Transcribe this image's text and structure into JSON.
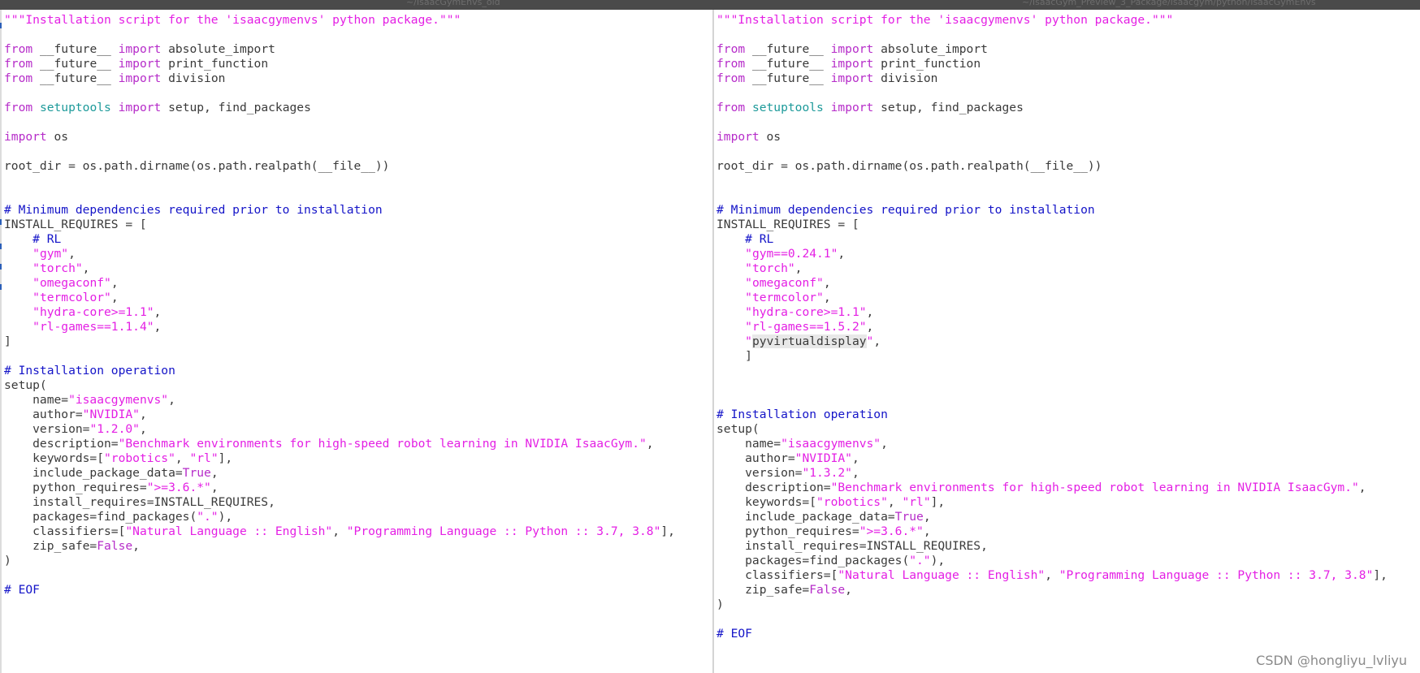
{
  "window": {
    "left_title": "~/IsaacGymEnvs_old",
    "right_title": "~/IsaacGym_Preview_3_Package/isaacgym/python/IsaacGymEnvs"
  },
  "watermark": "CSDN @hongliyu_lvliyu",
  "colors": {
    "keyword": "#b62cc9",
    "module": "#1d9a9a",
    "string": "#e41fe4",
    "comment": "#1414c8",
    "text": "#3a3a3a"
  },
  "left_pane": {
    "lines": [
      [
        [
          "str",
          "\"\"\"Installation script for the 'isaacgymenvs' python package.\"\"\""
        ]
      ],
      [],
      [
        [
          "kw",
          "from"
        ],
        [
          "t",
          " __future__ "
        ],
        [
          "kw",
          "import"
        ],
        [
          "t",
          " absolute_import"
        ]
      ],
      [
        [
          "kw",
          "from"
        ],
        [
          "t",
          " __future__ "
        ],
        [
          "kw",
          "import"
        ],
        [
          "t",
          " print_function"
        ]
      ],
      [
        [
          "kw",
          "from"
        ],
        [
          "t",
          " __future__ "
        ],
        [
          "kw",
          "import"
        ],
        [
          "t",
          " division"
        ]
      ],
      [],
      [
        [
          "kw",
          "from"
        ],
        [
          "t",
          " "
        ],
        [
          "mod",
          "setuptools"
        ],
        [
          "t",
          " "
        ],
        [
          "kw",
          "import"
        ],
        [
          "t",
          " setup, find_packages"
        ]
      ],
      [],
      [
        [
          "kw",
          "import"
        ],
        [
          "t",
          " os"
        ]
      ],
      [],
      [
        [
          "t",
          "root_dir = os.path.dirname(os.path.realpath(__file__))"
        ]
      ],
      [],
      [],
      [
        [
          "cmt",
          "# Minimum dependencies required prior to installation"
        ]
      ],
      [
        [
          "t",
          "INSTALL_REQUIRES = ["
        ]
      ],
      [
        [
          "t",
          "    "
        ],
        [
          "cmt",
          "# RL"
        ]
      ],
      [
        [
          "t",
          "    "
        ],
        [
          "str",
          "\"gym\""
        ],
        [
          "t",
          ","
        ]
      ],
      [
        [
          "t",
          "    "
        ],
        [
          "str",
          "\"torch\""
        ],
        [
          "t",
          ","
        ]
      ],
      [
        [
          "t",
          "    "
        ],
        [
          "str",
          "\"omegaconf\""
        ],
        [
          "t",
          ","
        ]
      ],
      [
        [
          "t",
          "    "
        ],
        [
          "str",
          "\"termcolor\""
        ],
        [
          "t",
          ","
        ]
      ],
      [
        [
          "t",
          "    "
        ],
        [
          "str",
          "\"hydra-core>=1.1\""
        ],
        [
          "t",
          ","
        ]
      ],
      [
        [
          "t",
          "    "
        ],
        [
          "str",
          "\"rl-games==1.1.4\""
        ],
        [
          "t",
          ","
        ]
      ],
      [
        [
          "t",
          "]"
        ]
      ],
      [],
      [
        [
          "cmt",
          "# Installation operation"
        ]
      ],
      [
        [
          "t",
          "setup("
        ]
      ],
      [
        [
          "t",
          "    name="
        ],
        [
          "str",
          "\"isaacgymenvs\""
        ],
        [
          "t",
          ","
        ]
      ],
      [
        [
          "t",
          "    author="
        ],
        [
          "str",
          "\"NVIDIA\""
        ],
        [
          "t",
          ","
        ]
      ],
      [
        [
          "t",
          "    version="
        ],
        [
          "str",
          "\"1.2.0\""
        ],
        [
          "t",
          ","
        ]
      ],
      [
        [
          "t",
          "    description="
        ],
        [
          "str",
          "\"Benchmark environments for high-speed robot learning in NVIDIA IsaacGym.\""
        ],
        [
          "t",
          ","
        ]
      ],
      [
        [
          "t",
          "    keywords=["
        ],
        [
          "str",
          "\"robotics\""
        ],
        [
          "t",
          ", "
        ],
        [
          "str",
          "\"rl\""
        ],
        [
          "t",
          "],"
        ]
      ],
      [
        [
          "t",
          "    include_package_data="
        ],
        [
          "kw",
          "True"
        ],
        [
          "t",
          ","
        ]
      ],
      [
        [
          "t",
          "    python_requires="
        ],
        [
          "str",
          "\">=3.6.*\""
        ],
        [
          "t",
          ","
        ]
      ],
      [
        [
          "t",
          "    install_requires=INSTALL_REQUIRES,"
        ]
      ],
      [
        [
          "t",
          "    packages=find_packages("
        ],
        [
          "str",
          "\".\""
        ],
        [
          "t",
          "),"
        ]
      ],
      [
        [
          "t",
          "    classifiers=["
        ],
        [
          "str",
          "\"Natural Language :: English\""
        ],
        [
          "t",
          ", "
        ],
        [
          "str",
          "\"Programming Language :: Python :: 3.7, 3.8\""
        ],
        [
          "t",
          "],"
        ]
      ],
      [
        [
          "t",
          "    zip_safe="
        ],
        [
          "kw",
          "False"
        ],
        [
          "t",
          ","
        ]
      ],
      [
        [
          "t",
          ")"
        ]
      ],
      [],
      [
        [
          "cmt",
          "# EOF"
        ]
      ]
    ]
  },
  "right_pane": {
    "lines": [
      [
        [
          "str",
          "\"\"\"Installation script for the 'isaacgymenvs' python package.\"\"\""
        ]
      ],
      [],
      [
        [
          "kw",
          "from"
        ],
        [
          "t",
          " __future__ "
        ],
        [
          "kw",
          "import"
        ],
        [
          "t",
          " absolute_import"
        ]
      ],
      [
        [
          "kw",
          "from"
        ],
        [
          "t",
          " __future__ "
        ],
        [
          "kw",
          "import"
        ],
        [
          "t",
          " print_function"
        ]
      ],
      [
        [
          "kw",
          "from"
        ],
        [
          "t",
          " __future__ "
        ],
        [
          "kw",
          "import"
        ],
        [
          "t",
          " division"
        ]
      ],
      [],
      [
        [
          "kw",
          "from"
        ],
        [
          "t",
          " "
        ],
        [
          "mod",
          "setuptools"
        ],
        [
          "t",
          " "
        ],
        [
          "kw",
          "import"
        ],
        [
          "t",
          " setup, find_packages"
        ]
      ],
      [],
      [
        [
          "kw",
          "import"
        ],
        [
          "t",
          " os"
        ]
      ],
      [],
      [
        [
          "t",
          "root_dir = os.path.dirname(os.path.realpath(__file__))"
        ]
      ],
      [],
      [],
      [
        [
          "cmt",
          "# Minimum dependencies required prior to installation"
        ]
      ],
      [
        [
          "t",
          "INSTALL_REQUIRES = ["
        ]
      ],
      [
        [
          "t",
          "    "
        ],
        [
          "cmt",
          "# RL"
        ]
      ],
      [
        [
          "t",
          "    "
        ],
        [
          "str",
          "\"gym==0.24.1\""
        ],
        [
          "t",
          ","
        ]
      ],
      [
        [
          "t",
          "    "
        ],
        [
          "str",
          "\"torch\""
        ],
        [
          "t",
          ","
        ]
      ],
      [
        [
          "t",
          "    "
        ],
        [
          "str",
          "\"omegaconf\""
        ],
        [
          "t",
          ","
        ]
      ],
      [
        [
          "t",
          "    "
        ],
        [
          "str",
          "\"termcolor\""
        ],
        [
          "t",
          ","
        ]
      ],
      [
        [
          "t",
          "    "
        ],
        [
          "str",
          "\"hydra-core>=1.1\""
        ],
        [
          "t",
          ","
        ]
      ],
      [
        [
          "t",
          "    "
        ],
        [
          "str",
          "\"rl-games==1.5.2\""
        ],
        [
          "t",
          ","
        ]
      ],
      [
        [
          "t",
          "    "
        ],
        [
          "str",
          "\""
        ],
        [
          "hl",
          "pyvirtualdisplay"
        ],
        [
          "str",
          "\""
        ],
        [
          "t",
          ","
        ]
      ],
      [
        [
          "t",
          "    ]"
        ]
      ],
      [],
      [],
      [],
      [
        [
          "cmt",
          "# Installation operation"
        ]
      ],
      [
        [
          "t",
          "setup("
        ]
      ],
      [
        [
          "t",
          "    name="
        ],
        [
          "str",
          "\"isaacgymenvs\""
        ],
        [
          "t",
          ","
        ]
      ],
      [
        [
          "t",
          "    author="
        ],
        [
          "str",
          "\"NVIDIA\""
        ],
        [
          "t",
          ","
        ]
      ],
      [
        [
          "t",
          "    version="
        ],
        [
          "str",
          "\"1.3.2\""
        ],
        [
          "t",
          ","
        ]
      ],
      [
        [
          "t",
          "    description="
        ],
        [
          "str",
          "\"Benchmark environments for high-speed robot learning in NVIDIA IsaacGym.\""
        ],
        [
          "t",
          ","
        ]
      ],
      [
        [
          "t",
          "    keywords=["
        ],
        [
          "str",
          "\"robotics\""
        ],
        [
          "t",
          ", "
        ],
        [
          "str",
          "\"rl\""
        ],
        [
          "t",
          "],"
        ]
      ],
      [
        [
          "t",
          "    include_package_data="
        ],
        [
          "kw",
          "True"
        ],
        [
          "t",
          ","
        ]
      ],
      [
        [
          "t",
          "    python_requires="
        ],
        [
          "str",
          "\">=3.6.*\""
        ],
        [
          "t",
          ","
        ]
      ],
      [
        [
          "t",
          "    install_requires=INSTALL_REQUIRES,"
        ]
      ],
      [
        [
          "t",
          "    packages=find_packages("
        ],
        [
          "str",
          "\".\""
        ],
        [
          "t",
          "),"
        ]
      ],
      [
        [
          "t",
          "    classifiers=["
        ],
        [
          "str",
          "\"Natural Language :: English\""
        ],
        [
          "t",
          ", "
        ],
        [
          "str",
          "\"Programming Language :: Python :: 3.7, 3.8\""
        ],
        [
          "t",
          "],"
        ]
      ],
      [
        [
          "t",
          "    zip_safe="
        ],
        [
          "kw",
          "False"
        ],
        [
          "t",
          ","
        ]
      ],
      [
        [
          "t",
          ")"
        ]
      ],
      [],
      [
        [
          "cmt",
          "# EOF"
        ]
      ]
    ]
  }
}
